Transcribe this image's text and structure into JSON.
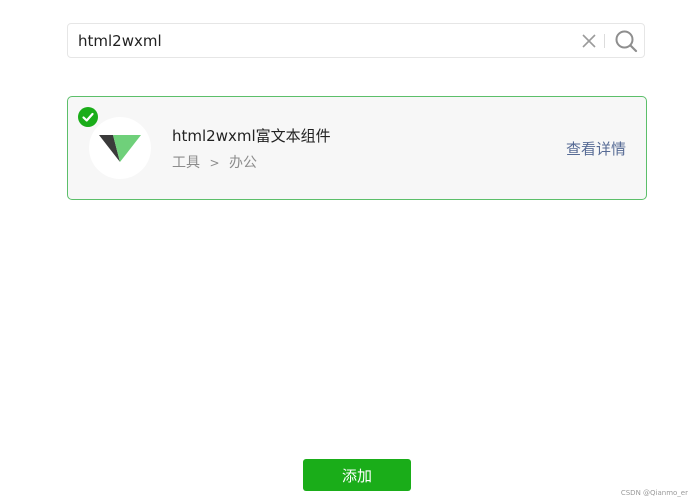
{
  "search": {
    "value": "html2wxml",
    "clear_icon": "close-icon",
    "search_icon": "search-icon"
  },
  "result": {
    "selected": true,
    "name": "html2wxml富文本组件",
    "category_parent": "工具",
    "category_separator": ">",
    "category_child": "办公",
    "detail_label": "查看详情",
    "logo_icon": "v-logo-icon",
    "check_icon": "check-icon"
  },
  "footer": {
    "add_label": "添加"
  },
  "watermark": "CSDN @Qianmo_er",
  "colors": {
    "primary_green": "#1aad19",
    "card_border": "#5cbf6a",
    "link_blue": "#576b95",
    "logo_dark": "#3a3a3a",
    "logo_green": "#6fd07a"
  }
}
